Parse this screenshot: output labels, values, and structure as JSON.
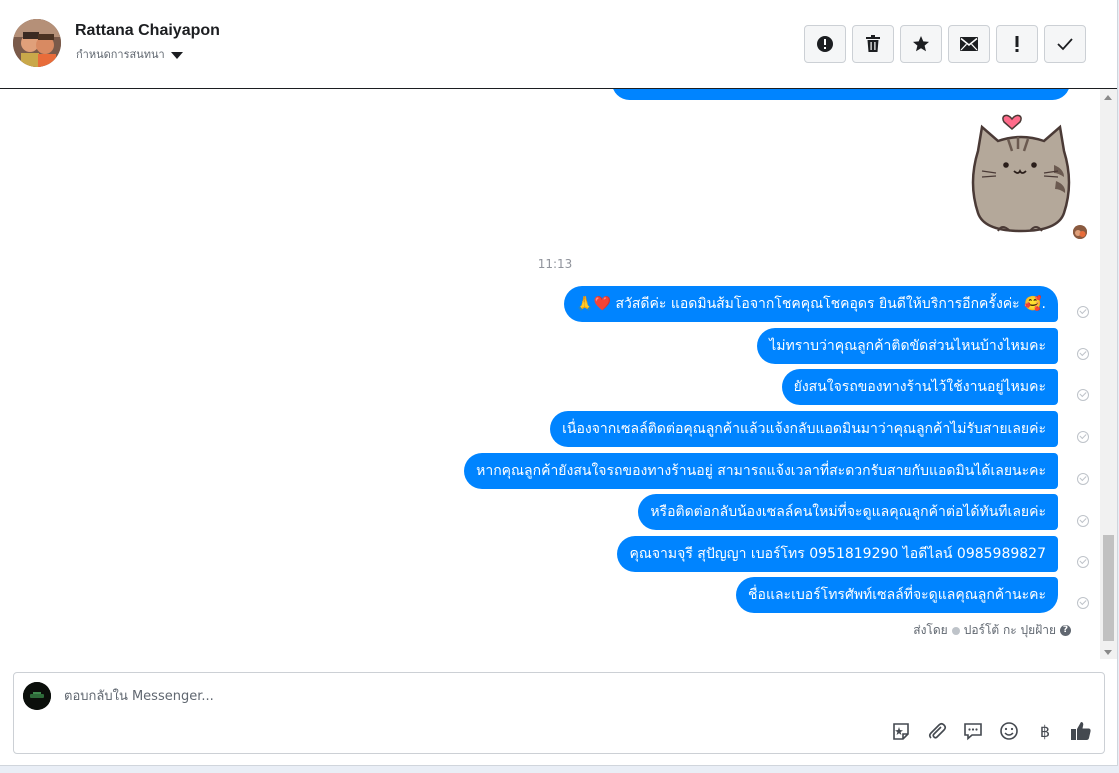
{
  "header": {
    "contact_name": "Rattana Chaiyapon",
    "assign_label": "กำหนดการสนทนา",
    "toolbar": [
      {
        "name": "report-spam-button",
        "icon": "alert-circle-icon"
      },
      {
        "name": "delete-button",
        "icon": "trash-icon"
      },
      {
        "name": "star-button",
        "icon": "star-icon"
      },
      {
        "name": "mark-unread-button",
        "icon": "envelope-icon"
      },
      {
        "name": "follow-up-button",
        "icon": "exclamation-icon"
      },
      {
        "name": "mark-done-button",
        "icon": "checkmark-icon"
      }
    ]
  },
  "conversation": {
    "timestamp": "11:13",
    "messages": [
      {
        "text": "🙏❤️ สวัสดีค่ะ แอดมินส้มโอจากโชคคุณโชคอุดร ยินดีให้บริการอีกครั้งค่ะ 🥰."
      },
      {
        "text": "ไม่ทราบว่าคุณลูกค้าติดขัดส่วนไหนบ้างไหมคะ"
      },
      {
        "text": "ยังสนใจรถของทางร้านไว้ใช้งานอยู่ไหมคะ"
      },
      {
        "text": "เนื่องจากเซลล์ติดต่อคุณลูกค้าแล้วแจ้งกลับแอดมินมาว่าคุณลูกค้าไม่รับสายเลยค่ะ"
      },
      {
        "text": "หากคุณลูกค้ายังสนใจรถของทางร้านอยู่  สามารถแจ้งเวลาที่สะดวกรับสายกับแอดมินได้เลยนะคะ"
      },
      {
        "text": "หรือติดต่อกลับน้องเซลล์คนใหม่ที่จะดูแลคุณลูกค้าต่อได้ทันทีเลยค่ะ"
      },
      {
        "text": "คุณจามจุรี สุปัญญา เบอร์โทร 0951819290  ไอดีไลน์ 0985989827"
      },
      {
        "text": "ชื่อและเบอร์โทรศัพท์เซลล์ที่จะดูแลคุณลูกค้านะคะ"
      }
    ],
    "sent_by_label": "ส่งโดย",
    "sent_by_name": "ปอร์โต้ กะ ปุยฝ้าย",
    "help_mark": "?"
  },
  "composer": {
    "placeholder": "ตอบกลับใน Messenger...",
    "icons": [
      "sticker-icon",
      "attachment-icon",
      "saved-replies-icon",
      "emoji-icon",
      "baht-payment-icon",
      "like-icon"
    ],
    "currency_symbol": "฿"
  },
  "colors": {
    "bubble": "#0084ff",
    "header_text": "#1c1e21",
    "muted": "#606770"
  }
}
